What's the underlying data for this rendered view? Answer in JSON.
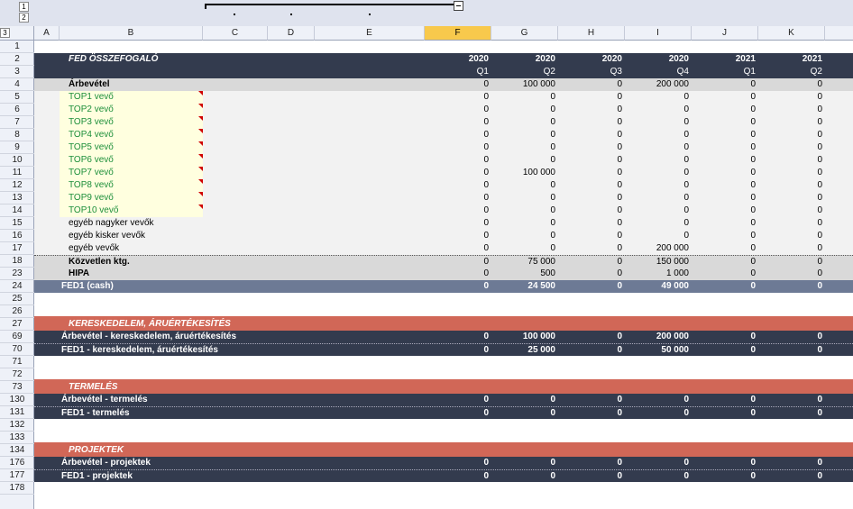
{
  "outline": {
    "levels": [
      "1",
      "2",
      "3"
    ]
  },
  "columns": [
    "A",
    "B",
    "C",
    "D",
    "E",
    "F",
    "G",
    "H",
    "I",
    "J",
    "K"
  ],
  "selected_column": "F",
  "rows_numbers": [
    "1",
    "2",
    "3",
    "4",
    "5",
    "6",
    "7",
    "8",
    "9",
    "10",
    "11",
    "12",
    "13",
    "14",
    "15",
    "16",
    "17",
    "18",
    "23",
    "24",
    "25",
    "26",
    "27",
    "69",
    "70",
    "71",
    "72",
    "73",
    "130",
    "131",
    "132",
    "133",
    "134",
    "176",
    "177",
    "178"
  ],
  "colors": {
    "header_dark": "#333b4e",
    "sum_row": "#6d7a95",
    "section_red": "#d16757",
    "light_gray": "#f2f2f2",
    "mid_gray": "#d9d9d9",
    "top_green": "#1d8f3a",
    "top_bg": "#ffffdf"
  },
  "summary": {
    "title": "FED ÖSSZEFOGALÓ",
    "years": [
      "2020",
      "2020",
      "2020",
      "2020",
      "2021",
      "2021"
    ],
    "quarters": [
      "Q1",
      "Q2",
      "Q3",
      "Q4",
      "Q1",
      "Q2"
    ],
    "revenue": {
      "label": "Árbevétel",
      "values": [
        "0",
        "100 000",
        "0",
        "200 000",
        "0",
        "0"
      ]
    },
    "top_customers": [
      {
        "label": "TOP1 vevő",
        "values": [
          "0",
          "0",
          "0",
          "0",
          "0",
          "0"
        ]
      },
      {
        "label": "TOP2 vevő",
        "values": [
          "0",
          "0",
          "0",
          "0",
          "0",
          "0"
        ]
      },
      {
        "label": "TOP3 vevő",
        "values": [
          "0",
          "0",
          "0",
          "0",
          "0",
          "0"
        ]
      },
      {
        "label": "TOP4 vevő",
        "values": [
          "0",
          "0",
          "0",
          "0",
          "0",
          "0"
        ]
      },
      {
        "label": "TOP5 vevő",
        "values": [
          "0",
          "0",
          "0",
          "0",
          "0",
          "0"
        ]
      },
      {
        "label": "TOP6 vevő",
        "values": [
          "0",
          "0",
          "0",
          "0",
          "0",
          "0"
        ]
      },
      {
        "label": "TOP7 vevő",
        "values": [
          "0",
          "100 000",
          "0",
          "0",
          "0",
          "0"
        ]
      },
      {
        "label": "TOP8 vevő",
        "values": [
          "0",
          "0",
          "0",
          "0",
          "0",
          "0"
        ]
      },
      {
        "label": "TOP9 vevő",
        "values": [
          "0",
          "0",
          "0",
          "0",
          "0",
          "0"
        ]
      },
      {
        "label": "TOP10 vevő",
        "values": [
          "0",
          "0",
          "0",
          "0",
          "0",
          "0"
        ]
      }
    ],
    "other_customers": [
      {
        "label": "egyéb nagyker vevők",
        "values": [
          "0",
          "0",
          "0",
          "0",
          "0",
          "0"
        ]
      },
      {
        "label": "egyéb kisker vevők",
        "values": [
          "0",
          "0",
          "0",
          "0",
          "0",
          "0"
        ]
      },
      {
        "label": "egyéb vevők",
        "values": [
          "0",
          "0",
          "0",
          "200 000",
          "0",
          "0"
        ]
      }
    ],
    "direct_costs": {
      "label": "Közvetlen ktg.",
      "values": [
        "0",
        "75 000",
        "0",
        "150 000",
        "0",
        "0"
      ]
    },
    "hipa": {
      "label": "HIPA",
      "values": [
        "0",
        "500",
        "0",
        "1 000",
        "0",
        "0"
      ]
    },
    "fed1_cash": {
      "label": "FED1 (cash)",
      "values": [
        "0",
        "24 500",
        "0",
        "49 000",
        "0",
        "0"
      ]
    }
  },
  "sections": [
    {
      "title": "KERESKEDELEM, ÁRUÉRTÉKESÍTÉS",
      "lines": [
        {
          "label": "Árbevétel - kereskedelem, áruértékesítés",
          "values": [
            "0",
            "100 000",
            "0",
            "200 000",
            "0",
            "0"
          ]
        },
        {
          "label": "FED1 - kereskedelem, áruértékesítés",
          "values": [
            "0",
            "25 000",
            "0",
            "50 000",
            "0",
            "0"
          ]
        }
      ]
    },
    {
      "title": "TERMELÉS",
      "lines": [
        {
          "label": "Árbevétel - termelés",
          "values": [
            "0",
            "0",
            "0",
            "0",
            "0",
            "0"
          ]
        },
        {
          "label": "FED1 - termelés",
          "values": [
            "0",
            "0",
            "0",
            "0",
            "0",
            "0"
          ]
        }
      ]
    },
    {
      "title": "PROJEKTEK",
      "lines": [
        {
          "label": "Árbevétel - projektek",
          "values": [
            "0",
            "0",
            "0",
            "0",
            "0",
            "0"
          ]
        },
        {
          "label": "FED1 - projektek",
          "values": [
            "0",
            "0",
            "0",
            "0",
            "0",
            "0"
          ]
        }
      ]
    }
  ]
}
